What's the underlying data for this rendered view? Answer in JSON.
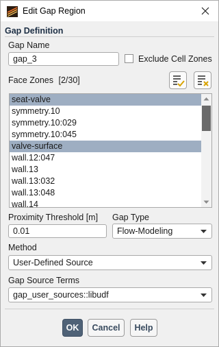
{
  "window": {
    "title": "Edit Gap Region"
  },
  "gap_definition": {
    "section_title": "Gap Definition",
    "gap_name_label": "Gap Name",
    "gap_name_value": "gap_3",
    "exclude_cell_zones_label": "Exclude Cell Zones",
    "exclude_cell_zones_checked": false,
    "face_zones_label": "Face Zones",
    "face_zones_count": "[2/30]",
    "face_zones": [
      {
        "label": "seat-valve",
        "selected": true
      },
      {
        "label": "symmetry.10",
        "selected": false
      },
      {
        "label": "symmetry.10:029",
        "selected": false
      },
      {
        "label": "symmetry.10:045",
        "selected": false
      },
      {
        "label": "valve-surface",
        "selected": true
      },
      {
        "label": "wall.12:047",
        "selected": false
      },
      {
        "label": "wall.13",
        "selected": false
      },
      {
        "label": "wall.13:032",
        "selected": false
      },
      {
        "label": "wall.13:048",
        "selected": false
      },
      {
        "label": "wall.14",
        "selected": false
      }
    ],
    "select_all_icon": "select-all-icon",
    "deselect_all_icon": "deselect-all-icon",
    "proximity_threshold_label": "Proximity Threshold [m]",
    "proximity_threshold_value": "0.01",
    "gap_type_label": "Gap Type",
    "gap_type_value": "Flow-Modeling",
    "method_label": "Method",
    "method_value": "User-Defined Source",
    "gap_source_terms_label": "Gap Source Terms",
    "gap_source_terms_value": "gap_user_sources::libudf"
  },
  "buttons": {
    "ok": "OK",
    "cancel": "Cancel",
    "help": "Help"
  },
  "colors": {
    "selection": "#9eaec2",
    "primary_button": "#4f6277",
    "section_title": "#1c2e44"
  }
}
